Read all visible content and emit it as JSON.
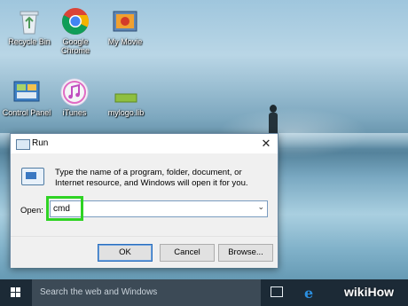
{
  "desktop": {
    "icons": [
      {
        "label": "Recycle Bin"
      },
      {
        "label": "Google Chrome"
      },
      {
        "label": "My Movie"
      },
      {
        "label": "Control Panel"
      },
      {
        "label": "iTunes"
      },
      {
        "label": "mylogo.lib"
      }
    ]
  },
  "run_dialog": {
    "title": "Run",
    "close_glyph": "✕",
    "description": "Type the name of a program, folder, document, or Internet resource, and Windows will open it for you.",
    "open_label": "Open:",
    "input_value": "cmd",
    "dropdown_glyph": "⌄",
    "ok_label": "OK",
    "cancel_label": "Cancel",
    "browse_label": "Browse...",
    "highlight_color": "#2fd324"
  },
  "taskbar": {
    "search_placeholder": "Search the web and Windows",
    "edge_glyph": "e"
  },
  "watermark": "wikiHow"
}
